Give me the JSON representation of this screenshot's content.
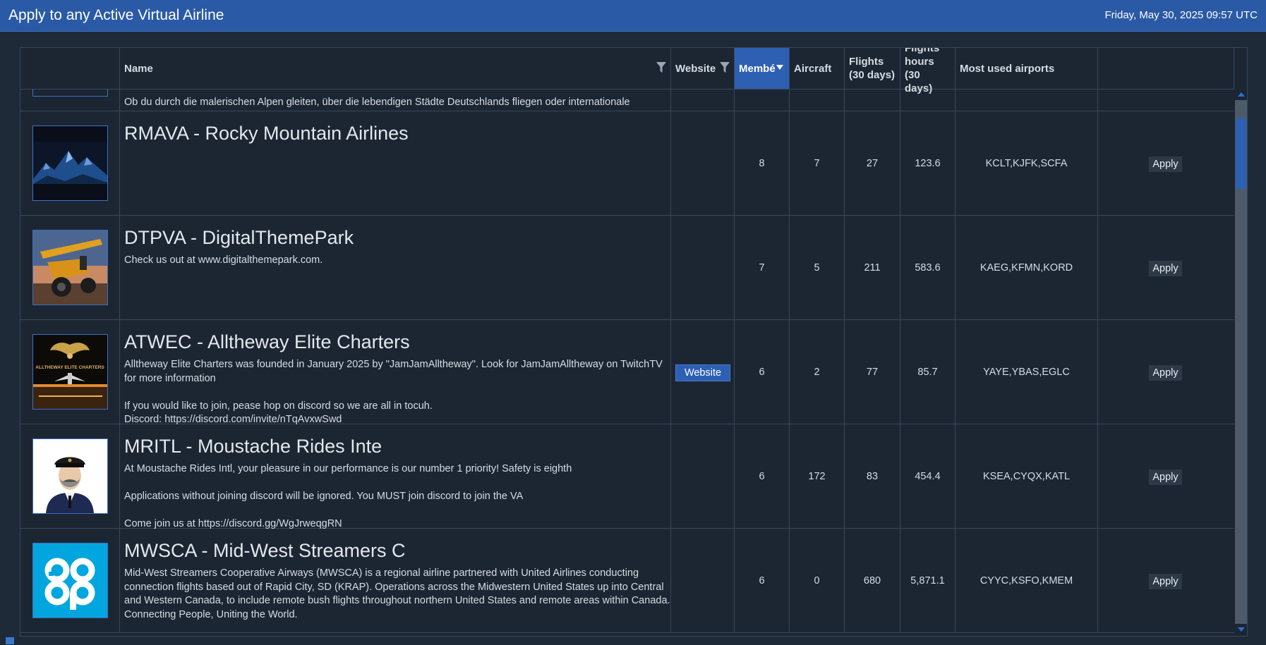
{
  "window": {
    "title": "Apply to any Active Virtual Airline",
    "datetime": "Friday, May 30, 2025 09:57 UTC"
  },
  "columns": {
    "name": "Name",
    "website": "Website",
    "members": "Membé",
    "aircraft": "Aircraft",
    "flights": "Flights\n(30 days)",
    "hours": "Flights\nhours (30\ndays)",
    "airports": "Most used airports"
  },
  "partial_row": {
    "desc": "Ob du durch die malerischen Alpen gleiten, über die lebendigen Städte Deutschlands fliegen oder internationale"
  },
  "rows": [
    {
      "name": "RMAVA - Rocky Mountain Airlines",
      "desc": "",
      "website": "",
      "members": "8",
      "aircraft": "7",
      "flights": "27",
      "hours": "123.6",
      "airports": "KCLT,KJFK,SCFA",
      "apply": "Apply",
      "logo": "mountain-logo"
    },
    {
      "name": "DTPVA - DigitalThemePark",
      "desc": "Check us out at www.digitalthemepark.com.",
      "website": "",
      "members": "7",
      "aircraft": "5",
      "flights": "211",
      "hours": "583.6",
      "airports": "KAEG,KFMN,KORD",
      "apply": "Apply",
      "logo": "bush-plane-logo"
    },
    {
      "name": "ATWEC - Alltheway Elite Charters",
      "desc": "Alltheway Elite Charters was founded in January 2025 by \"JamJamAlltheway\". Look for JamJamAlltheway on TwitchTV for more information\n\nIf you would like to join, pease hop on discord so we are all in tocuh.\nDiscord: https://discord.com/invite/nTqAvxwSwd",
      "website": "Website",
      "members": "6",
      "aircraft": "2",
      "flights": "77",
      "hours": "85.7",
      "airports": "YAYE,YBAS,EGLC",
      "apply": "Apply",
      "logo": "winged-jet-logo",
      "logo_text": "ALLTHEWAY ELITE CHARTERS"
    },
    {
      "name": "MRITL - Moustache Rides Inte",
      "desc": "At Moustache Rides Intl, your pleasure in our performance is our number 1 priority! Safety is eighth\n\nApplications without joining discord will be ignored. You MUST join discord to join the VA\n\nCome join us at https://discord.gg/WgJrweqgRN",
      "website": "",
      "members": "6",
      "aircraft": "172",
      "flights": "83",
      "hours": "454.4",
      "airports": "KSEA,CYQX,KATL",
      "apply": "Apply",
      "logo": "pilot-logo"
    },
    {
      "name": "MWSCA - Mid-West Streamers C",
      "desc": "Mid-West Streamers Cooperative Airways (MWSCA) is a regional airline partnered with United Airlines conducting connection flights based out of Rapid City, SD (KRAP). Operations across the Midwestern United States up into Central and Western Canada, to include remote bush flights throughout northern United States and remote areas within Canada. Connecting People, Uniting the World.",
      "website": "",
      "members": "6",
      "aircraft": "0",
      "flights": "680",
      "hours": "5,871.1",
      "airports": "CYYC,KSFO,KMEM",
      "apply": "Apply",
      "logo": "coop-logo",
      "logo_text": "co op"
    }
  ],
  "colors": {
    "titlebar": "#2a5aa6",
    "background": "#1f2a38",
    "accent": "#2d5fb3"
  }
}
